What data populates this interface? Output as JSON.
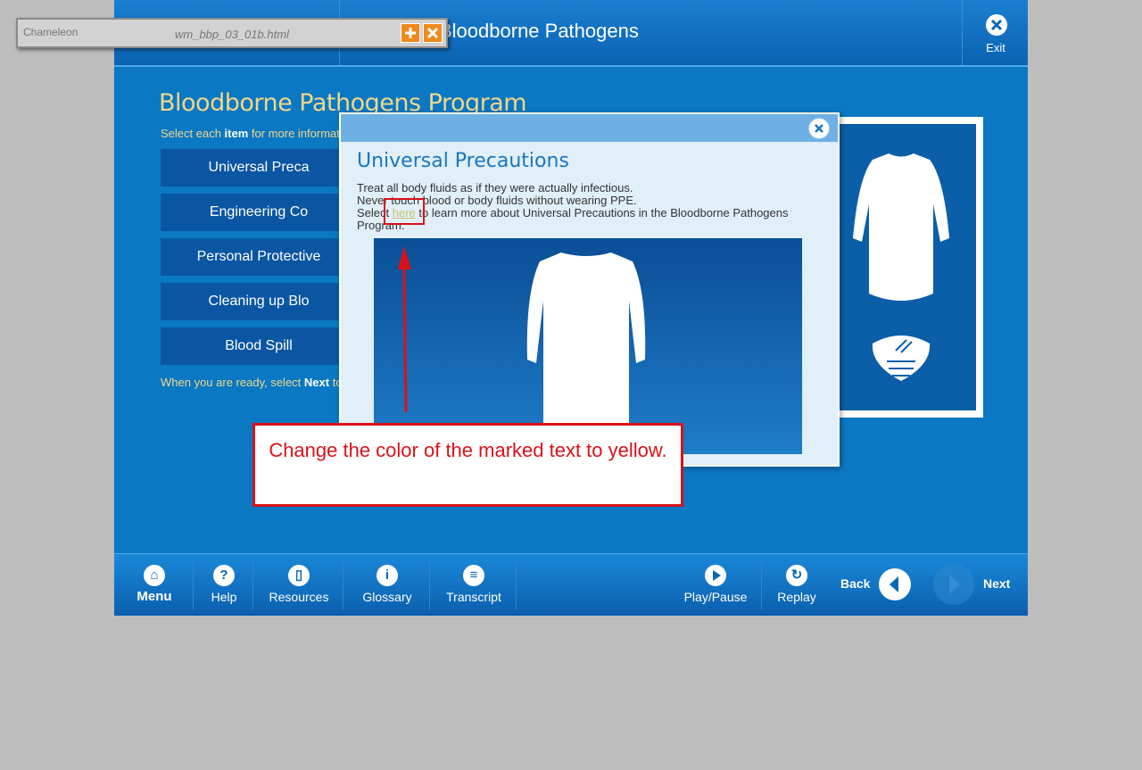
{
  "header": {
    "title": "Bloodborne Pathogens",
    "exit_label": "Exit"
  },
  "tool": {
    "logo": "Chameleon",
    "file_name": "wm_bbp_03_01b.html"
  },
  "page": {
    "title": "Bloodborne Pathogens Program",
    "instruction_pre": "Select each ",
    "instruction_bold": "item",
    "instruction_post": " for more informat",
    "menu_items": [
      "Universal Preca",
      "Engineering Co",
      "Personal Protective",
      "Cleaning up Blo",
      "Blood Spill"
    ],
    "ready_pre": "When you are ready, select ",
    "ready_bold": "Next",
    "ready_post": " to"
  },
  "popup": {
    "title": "Universal Precautions",
    "line1": "Treat all body fluids as if they were actually infectious.",
    "line2": "Never touch blood or body fluids without wearing PPE.",
    "line3_pre": "Select ",
    "line3_link": "here",
    "line3_post": " to learn more about Universal Precautions in the Bloodborne Pathogens",
    "line4": "Program."
  },
  "annotation": {
    "text": "Change the color of the marked text to yellow."
  },
  "footer": {
    "menu": "Menu",
    "help": "Help",
    "resources": "Resources",
    "glossary": "Glossary",
    "transcript": "Transcript",
    "play_pause": "Play/Pause",
    "replay": "Replay",
    "back": "Back",
    "next": "Next"
  },
  "colors": {
    "accent": "#0a78c2",
    "title_gold": "#f2d68a",
    "annotation_red": "#d9121a"
  }
}
